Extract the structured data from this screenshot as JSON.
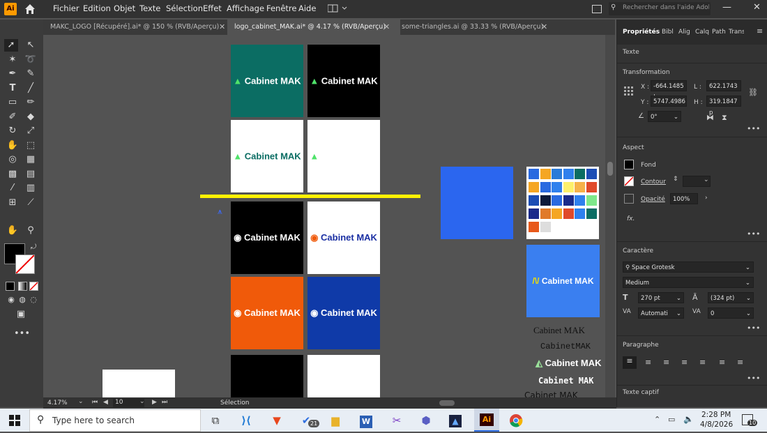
{
  "app": {
    "logo_text": "Ai",
    "home_icon": "home-icon"
  },
  "menu": {
    "items": [
      "Fichier",
      "Edition",
      "Objet",
      "Texte",
      "Sélection",
      "Effet",
      "Affichage",
      "Fenêtre",
      "Aide"
    ]
  },
  "search": {
    "placeholder": "Rechercher dans l'aide Adob"
  },
  "tabs": [
    {
      "label": "MAKC_LOGO [Récupéré].ai* @ 150 % (RVB/Aperçu)"
    },
    {
      "label": "logo_cabinet_MAK.ai* @ 4.17 % (RVB/Aperçu)"
    },
    {
      "label": "some-triangles.ai @ 33.33 % (RVB/Aperçu)"
    }
  ],
  "canvas": {
    "brand": "Cabinet MAK",
    "tiles": [
      {
        "bg": "#0b6d63",
        "fg": "#ffffff"
      },
      {
        "bg": "#000000",
        "fg": "#ffffff"
      },
      {
        "bg": "#ffffff",
        "fg": "#0b6d63"
      },
      {
        "bg": "#ffffff",
        "fg": "#ffffff"
      },
      {
        "bg": "#000000",
        "fg": "#ffffff"
      },
      {
        "bg": "#ffffff",
        "fg": "#1a2fa3"
      },
      {
        "bg": "#f05a0a",
        "fg": "#ffffff"
      },
      {
        "bg": "#0f3aa8",
        "fg": "#ffffff"
      },
      {
        "bg": "#000000",
        "fg": ""
      },
      {
        "bg": "#ffffff",
        "fg": ""
      }
    ],
    "swatches": [
      "#2a6ae0",
      "#f5a623",
      "#2a7bd8",
      "#2f80ed",
      "#0b6d63",
      "#1b4db5",
      "#f5a623",
      "#2a6ae0",
      "#2f80ed",
      "#fdf06b",
      "#f6b24a",
      "#e04a2a",
      "#1b4db5",
      "#0d1a3a",
      "#2a6ae0",
      "#1a2a8a",
      "#2f80ed",
      "#7ee88a",
      "#1a2a8a",
      "#e07a2a",
      "#f5a623",
      "#e04a2a",
      "#2f80ed",
      "#0b6d63",
      "#e8591a",
      "#dddddd",
      "#ffffff",
      "#ffffff",
      "#ffffff",
      "#ffffff"
    ],
    "blue_square": "#2b66ef",
    "accent_yellow": "#fff200",
    "type_samples": [
      "Cabinet MAK",
      "CabinetMAK",
      "Cabinet MAK",
      "Cabinet MAK",
      "Cabinet MAK"
    ]
  },
  "panel": {
    "tabs": [
      "Propriétés",
      "Bibl",
      "Alig",
      "Calq",
      "Path",
      "Trans"
    ],
    "section_text": "Texte",
    "transformation": {
      "title": "Transformation",
      "x_label": "X :",
      "x": "-664.1485 |",
      "y_label": "Y :",
      "y": "5747.4986",
      "w_label": "L :",
      "w": "622.1743 p",
      "h_label": "H :",
      "h": "319.1847 p",
      "angle": "0°"
    },
    "aspect": {
      "title": "Aspect",
      "fill": "Fond",
      "stroke": "Contour",
      "opacity_label": "Opacité",
      "opacity": "100%",
      "fx": "fx."
    },
    "character": {
      "title": "Caractère",
      "font": "Space Grotesk",
      "style": "Medium",
      "size": "270 pt",
      "leading": "(324 pt)",
      "kerning": "Automati",
      "tracking": "0"
    },
    "paragraph": {
      "title": "Paragraphe"
    },
    "captive": {
      "title": "Texte captif"
    }
  },
  "status": {
    "zoom": "4.17%",
    "page": "10",
    "tool": "Sélection"
  },
  "taskbar": {
    "search_placeholder": "Type here to search",
    "time": "2:28 PM",
    "date": "4/8/2026",
    "badge": "21",
    "notif": "10"
  }
}
